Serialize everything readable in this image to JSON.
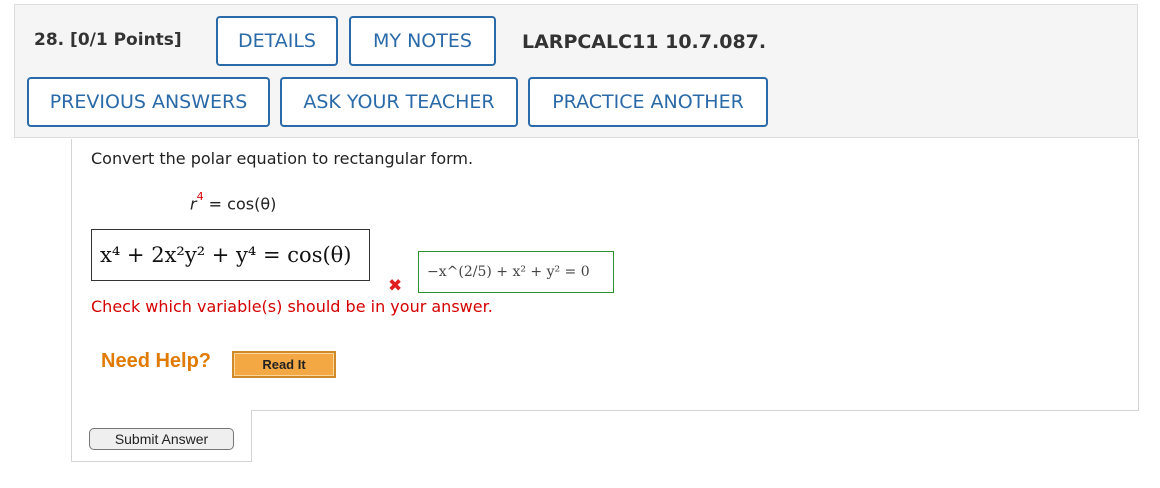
{
  "question": {
    "number": "28.",
    "points": "[0/1 Points]",
    "reference": "LARPCALC11 10.7.087."
  },
  "buttons": {
    "details": "DETAILS",
    "my_notes": "MY NOTES",
    "previous_answers": "PREVIOUS ANSWERS",
    "ask_teacher": "ASK YOUR TEACHER",
    "practice_another": "PRACTICE ANOTHER",
    "read_it": "Read It",
    "submit": "Submit Answer"
  },
  "problem": {
    "prompt": "Convert the polar equation to rectangular form.",
    "equation_lhs_var": "r",
    "equation_lhs_exp": "4",
    "equation_rhs": " = cos(θ)"
  },
  "answer": {
    "student": "x⁴ + 2x²y² + y⁴ = cos(θ)",
    "correct": "−x^(2/5) + x² + y² = 0",
    "status_icon": "wrong-icon",
    "feedback": "Check which variable(s) should be in your answer."
  },
  "help": {
    "label": "Need Help?"
  },
  "colors": {
    "button_border": "#2b6aa8",
    "error": "#d40000",
    "correct_border": "#2e8f2e",
    "help_orange": "#e07a00",
    "read_it_bg": "#f4a843"
  }
}
